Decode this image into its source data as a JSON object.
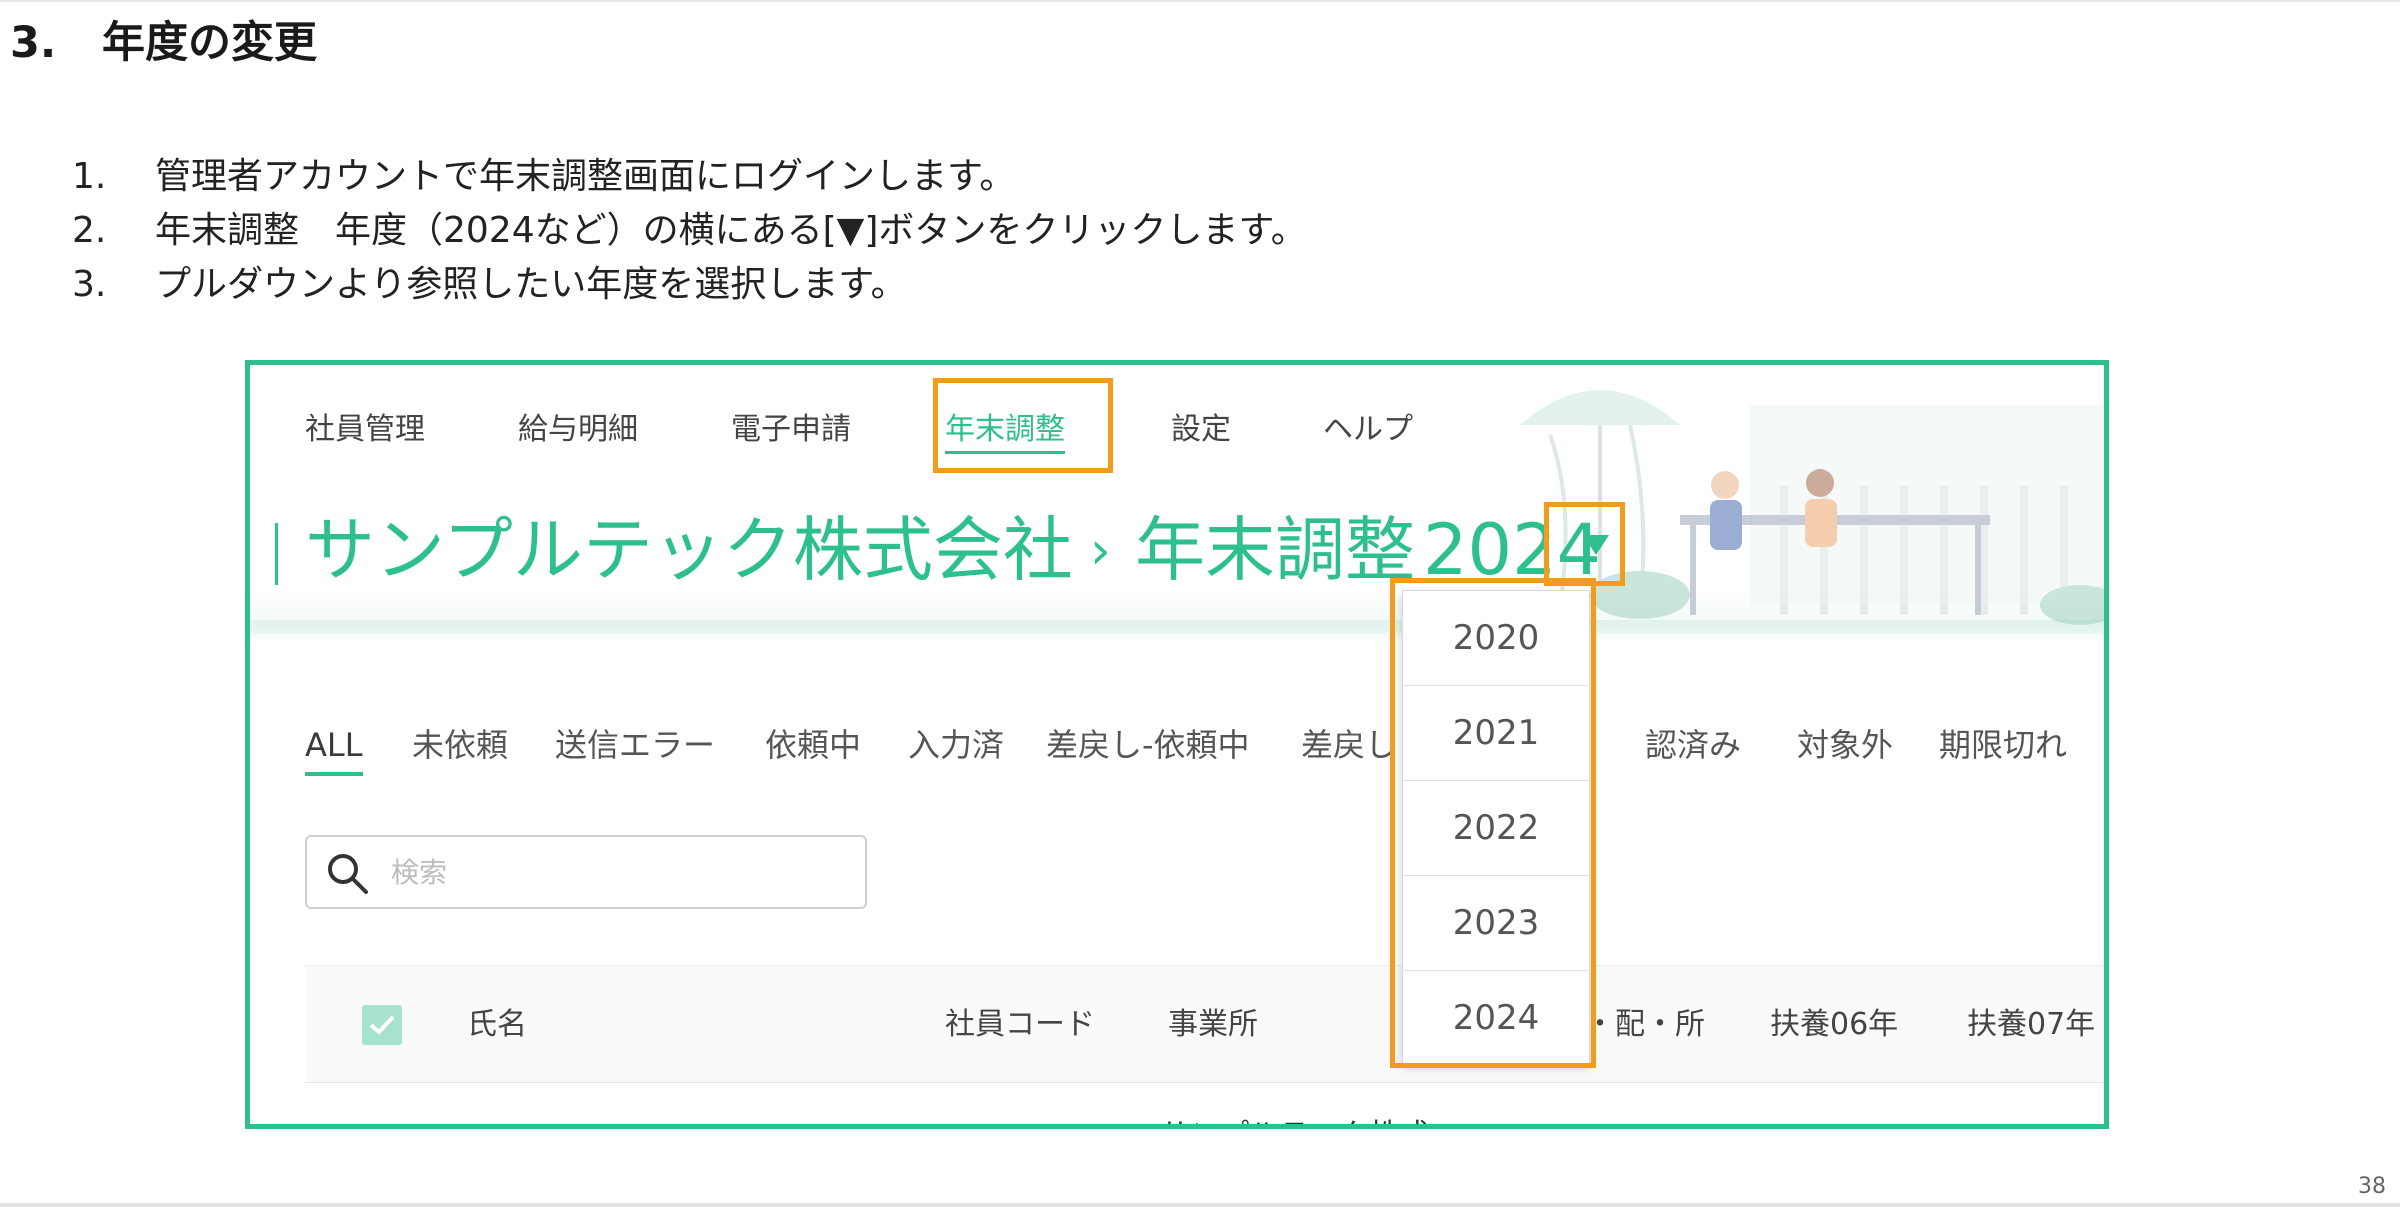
{
  "heading": {
    "number": "3.",
    "title": "年度の変更"
  },
  "steps": [
    {
      "num": "1.",
      "text": "管理者アカウントで年末調整画面にログインします。"
    },
    {
      "num": "2.",
      "text": "年末調整　年度（2024など）の横にある[▼]ボタンをクリックします。"
    },
    {
      "num": "3.",
      "text": "プルダウンより参照したい年度を選択します。"
    }
  ],
  "page_number": "38",
  "app": {
    "nav": [
      "社員管理",
      "給与明細",
      "電子申請",
      "年末調整",
      "設定",
      "ヘルプ"
    ],
    "nav_active": "年末調整",
    "breadcrumb": {
      "company": "サンプルテック株式会社",
      "separator": "›",
      "section": "年末調整",
      "year": "2024"
    },
    "status_tabs": [
      "ALL",
      "未依頼",
      "送信エラー",
      "依頼中",
      "入力済",
      "差戻し-依頼中",
      "差戻し",
      "確認済み",
      "対象外",
      "期限切れ"
    ],
    "status_tabs_visible": [
      "ALL",
      "未依頼",
      "送信エラー",
      "依頼中",
      "入力済",
      "差戻し-依頼中",
      "差戻し",
      "認済み",
      "対象外",
      "期限切れ"
    ],
    "search_placeholder": "検索",
    "table_columns": [
      "氏名",
      "社員コード",
      "事業所",
      "・配・所",
      "扶養06年",
      "扶養07年"
    ],
    "row_peek": "サンプルテック株式",
    "year_options": [
      "2020",
      "2021",
      "2022",
      "2023",
      "2024"
    ]
  },
  "colors": {
    "brand_green": "#2dbf8c",
    "highlight_orange": "#f39b1f"
  }
}
